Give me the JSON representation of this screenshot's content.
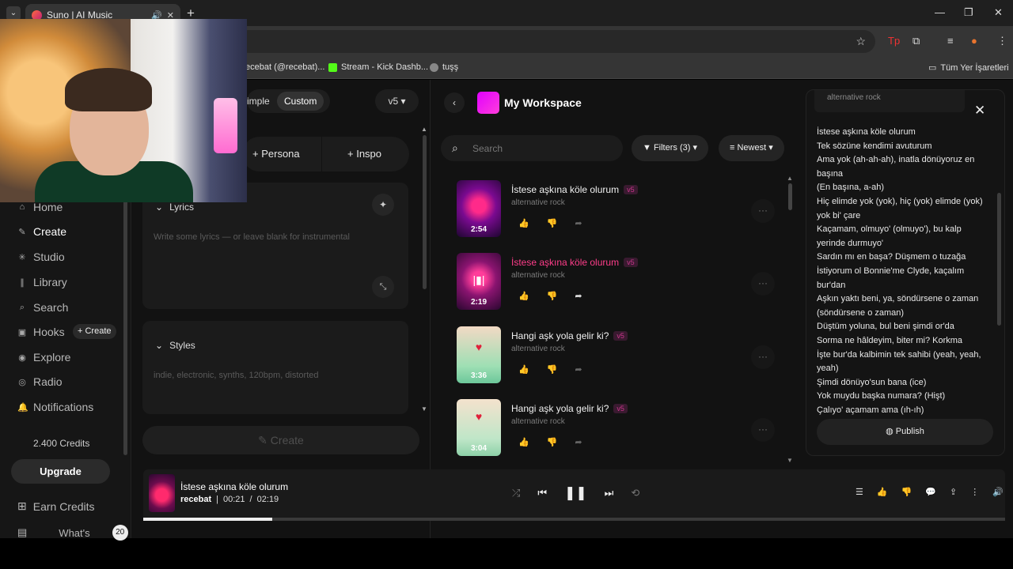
{
  "browser": {
    "tab_title": "Suno | AI Music",
    "bookmarks": [
      "ecebat (@recebat)...",
      "Stream - Kick Dashb...",
      "tuşş"
    ],
    "all_bookmarks": "Tüm Yer İşaretleri"
  },
  "sidebar": {
    "items": [
      {
        "label": "Home",
        "icon": "home-icon"
      },
      {
        "label": "Create",
        "icon": "create-icon"
      },
      {
        "label": "Studio",
        "icon": "studio-icon"
      },
      {
        "label": "Library",
        "icon": "library-icon"
      },
      {
        "label": "Search",
        "icon": "search-icon"
      },
      {
        "label": "Hooks",
        "icon": "hooks-icon"
      },
      {
        "label": "Explore",
        "icon": "explore-icon"
      },
      {
        "label": "Radio",
        "icon": "radio-icon"
      },
      {
        "label": "Notifications",
        "icon": "bell-icon"
      }
    ],
    "hooks_create": "+ Create",
    "credits": "2.400 Credits",
    "upgrade": "Upgrade",
    "earn_credits": "Earn Credits",
    "whats_new": "What's",
    "whats_badge": "20"
  },
  "create_panel": {
    "mode_simple": "imple",
    "mode_custom": "Custom",
    "version": "v5",
    "persona": "Persona",
    "inspo": "Inspo",
    "lyrics_label": "Lyrics",
    "lyrics_placeholder": "Write some lyrics — or leave blank for instrumental",
    "styles_label": "Styles",
    "styles_placeholder": "indie, electronic, synths, 120bpm, distorted",
    "create_button": "Create"
  },
  "workspace": {
    "title": "My Workspace",
    "search_placeholder": "Search",
    "filters": "Filters (3)",
    "sort": "Newest",
    "songs": [
      {
        "title": "İstese aşkına köle olurum",
        "version": "v5",
        "tag": "alternative rock",
        "duration": "2:54",
        "playing": false
      },
      {
        "title": "İstese aşkına köle olurum",
        "version": "v5",
        "tag": "alternative rock",
        "duration": "2:19",
        "playing": true
      },
      {
        "title": "Hangi aşk yola gelir ki?",
        "version": "v5",
        "tag": "alternative rock",
        "duration": "3:36",
        "playing": false
      },
      {
        "title": "Hangi aşk yola gelir ki?",
        "version": "v5",
        "tag": "alternative rock",
        "duration": "3:04",
        "playing": false
      }
    ]
  },
  "lyrics_panel": {
    "tag": "alternative rock",
    "lines": [
      "İstese aşkına köle olurum",
      "Tek sözüne kendimi avuturum",
      "Ama yok (ah-ah-ah), inatla dönüyoruz en başına",
      "(En başına, a-ah)",
      "Hiç elimde yok (yok), hiç (yok) elimde (yok) yok bi' çare",
      "Kaçamam, olmuyo' (olmuyo'), bu kalp yerinde durmuyo'",
      "Sardın mı en başa? Düşmem o tuzağa",
      "İstiyorum ol Bonnie'me Clyde, kaçalım bur'dan",
      "Aşkın yaktı beni, ya, söndürsene o zaman (söndürsene o zaman)",
      "Düştüm yoluna, bul beni şimdi or'da",
      "Sorma ne hâldeyim, biter mi? Korkma",
      "İşte bur'da kalbimin tek sahibi (yeah, yeah, yeah)",
      "Şimdi dönüyo'sun bana (ice)",
      "Yok muydu başka numara? (Hişt)",
      "Çalıyo' açamam ama (ıh-ıh)"
    ],
    "publish": "Publish"
  },
  "player": {
    "title": "İstese aşkına köle olurum",
    "artist": "recebat",
    "separator": "|",
    "current_time": "00:21",
    "time_sep": "/",
    "total_time": "02:19",
    "progress_fraction": 0.15
  }
}
